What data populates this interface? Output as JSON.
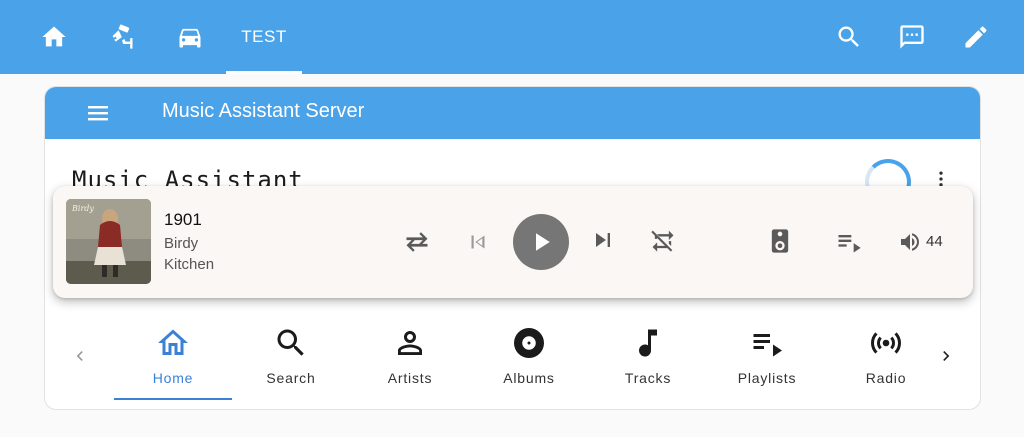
{
  "topbar": {
    "tabs": [
      {
        "icon": "home-icon"
      },
      {
        "icon": "cctv-icon"
      },
      {
        "icon": "car-icon"
      },
      {
        "label": "TEST",
        "active": true
      }
    ],
    "actions": [
      "search-icon",
      "message-icon",
      "pencil-icon"
    ],
    "color": "#4aa2e8"
  },
  "card": {
    "header_title": "Music Assistant Server",
    "app_title": "Music Assistant"
  },
  "player": {
    "track": "1901",
    "artist": "Birdy",
    "player_name": "Kitchen",
    "volume": "44",
    "background": "#faf7f5"
  },
  "bottom_nav": {
    "items": [
      {
        "label": "Home",
        "icon": "home-outline-icon",
        "active": true
      },
      {
        "label": "Search",
        "icon": "magnify-icon"
      },
      {
        "label": "Artists",
        "icon": "account-outline-icon"
      },
      {
        "label": "Albums",
        "icon": "album-icon"
      },
      {
        "label": "Tracks",
        "icon": "music-note-icon"
      },
      {
        "label": "Playlists",
        "icon": "playlist-play-icon"
      },
      {
        "label": "Radio",
        "icon": "radio-tower-icon"
      }
    ],
    "accent": "#3b82d6"
  }
}
